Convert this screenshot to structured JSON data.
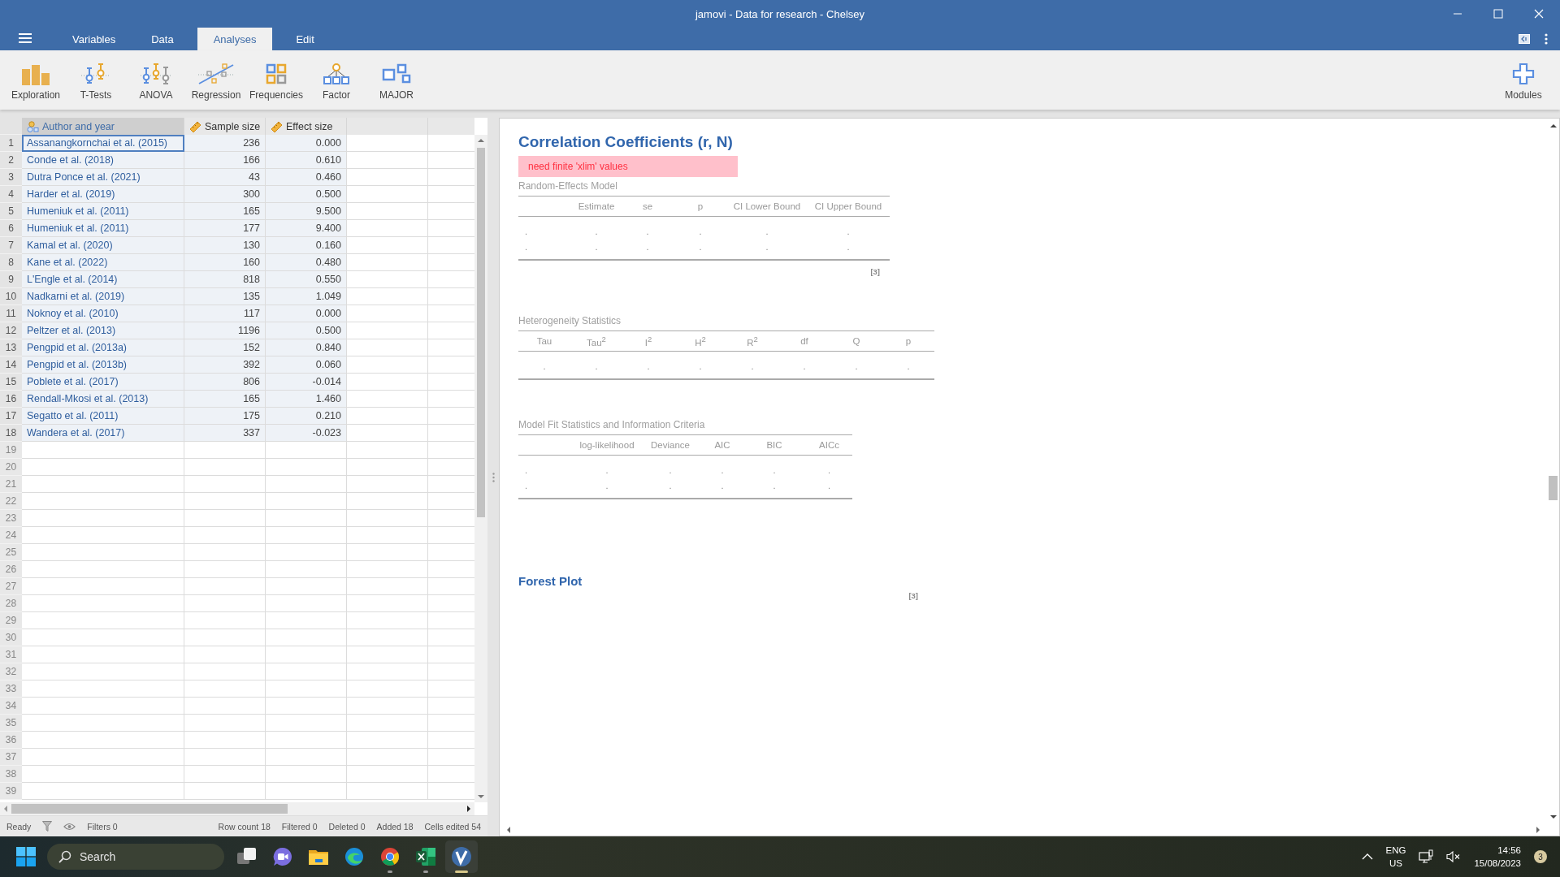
{
  "window": {
    "title": "jamovi - Data for research - Chelsey"
  },
  "menu_tabs": [
    {
      "label": "Variables",
      "selected": false
    },
    {
      "label": "Data",
      "selected": false
    },
    {
      "label": "Analyses",
      "selected": true
    },
    {
      "label": "Edit",
      "selected": false
    }
  ],
  "toolbar": [
    {
      "label": "Exploration",
      "kind": "exploration"
    },
    {
      "label": "T-Tests",
      "kind": "ttests"
    },
    {
      "label": "ANOVA",
      "kind": "anova"
    },
    {
      "label": "Regression",
      "kind": "regression"
    },
    {
      "label": "Frequencies",
      "kind": "frequencies"
    },
    {
      "label": "Factor",
      "kind": "factor"
    },
    {
      "label": "MAJOR",
      "kind": "major"
    }
  ],
  "modules": {
    "label": "Modules"
  },
  "spreadsheet": {
    "columns": [
      {
        "name": "Author and year",
        "kind": "nominal",
        "selected": true
      },
      {
        "name": "Sample size",
        "kind": "continuous",
        "selected": false
      },
      {
        "name": "Effect size",
        "kind": "continuous",
        "selected": false
      }
    ],
    "rows": [
      {
        "number": "1",
        "cells": [
          "Assanangkornchai et al. (2015)",
          "236",
          "0.000"
        ],
        "selected": true
      },
      {
        "number": "2",
        "cells": [
          "Conde et al. (2018)",
          "166",
          "0.610"
        ],
        "selected": false
      },
      {
        "number": "3",
        "cells": [
          "Dutra Ponce et al. (2021)",
          "43",
          "0.460"
        ],
        "selected": false
      },
      {
        "number": "4",
        "cells": [
          "Harder et al. (2019)",
          "300",
          "0.500"
        ],
        "selected": false
      },
      {
        "number": "5",
        "cells": [
          "Humeniuk et al. (2011)",
          "165",
          "9.500"
        ],
        "selected": false
      },
      {
        "number": "6",
        "cells": [
          "Humeniuk et al. (2011)",
          "177",
          "9.400"
        ],
        "selected": false
      },
      {
        "number": "7",
        "cells": [
          "Kamal et al. (2020)",
          "130",
          "0.160"
        ],
        "selected": false
      },
      {
        "number": "8",
        "cells": [
          "Kane et al. (2022)",
          "160",
          "0.480"
        ],
        "selected": false
      },
      {
        "number": "9",
        "cells": [
          "L'Engle et al. (2014)",
          "818",
          "0.550"
        ],
        "selected": false
      },
      {
        "number": "10",
        "cells": [
          "Nadkarni et al. (2019)",
          "135",
          "1.049"
        ],
        "selected": false
      },
      {
        "number": "11",
        "cells": [
          "Noknoy et al. (2010)",
          "117",
          "0.000"
        ],
        "selected": false
      },
      {
        "number": "12",
        "cells": [
          "Peltzer et al. (2013)",
          "1196",
          "0.500"
        ],
        "selected": false
      },
      {
        "number": "13",
        "cells": [
          "Pengpid et al. (2013a)",
          "152",
          "0.840"
        ],
        "selected": false
      },
      {
        "number": "14",
        "cells": [
          "Pengpid et al. (2013b)",
          "392",
          "0.060"
        ],
        "selected": false
      },
      {
        "number": "15",
        "cells": [
          "Poblete et al. (2017)",
          "806",
          "-0.014"
        ],
        "selected": false
      },
      {
        "number": "16",
        "cells": [
          "Rendall-Mkosi et al. (2013)",
          "165",
          "1.460"
        ],
        "selected": false
      },
      {
        "number": "17",
        "cells": [
          "Segatto et al. (2011)",
          "175",
          "0.210"
        ],
        "selected": false
      },
      {
        "number": "18",
        "cells": [
          "Wandera et al. (2017)",
          "337",
          "-0.023"
        ],
        "selected": false
      }
    ],
    "empty_row_numbers": [
      "19",
      "20",
      "21",
      "22",
      "23",
      "24",
      "25",
      "26",
      "27",
      "28",
      "29",
      "30",
      "31",
      "32",
      "33",
      "34",
      "35",
      "36",
      "37",
      "38",
      "39"
    ]
  },
  "status_bar": {
    "status": "Ready",
    "filters": "Filters 0",
    "row_count": "Row count 18",
    "filtered": "Filtered 0",
    "deleted": "Deleted 0",
    "added": "Added 18",
    "cells_edited": "Cells edited 54"
  },
  "results": {
    "title": "Correlation Coefficients (r, N)",
    "error": "need finite 'xlim' values",
    "tables": [
      {
        "kind": "random_effects",
        "title": "Random-Effects Model",
        "columns": [
          "",
          "Estimate",
          "se",
          "p",
          "CI Lower Bound",
          "CI Upper Bound"
        ],
        "rows": [
          [
            ".",
            ".",
            ".",
            ".",
            ".",
            "."
          ],
          [
            ".",
            ".",
            ".",
            ".",
            ".",
            "."
          ]
        ],
        "footnote": "[3]"
      },
      {
        "kind": "heterogeneity",
        "title": "Heterogeneity Statistics",
        "columns": [
          "Tau",
          "Tau$^{2}$",
          "I$^{2}$",
          "H$^{2}$",
          "R$^{2}$",
          "df",
          "Q",
          "p"
        ],
        "rows": [
          [
            ".",
            ".",
            ".",
            ".",
            ".",
            ".",
            ".",
            "."
          ]
        ]
      },
      {
        "kind": "model_fit",
        "title": "Model Fit Statistics and Information Criteria",
        "columns": [
          "",
          "log-likelihood",
          "Deviance",
          "AIC",
          "BIC",
          "AICc"
        ],
        "rows": [
          [
            ".",
            ".",
            ".",
            ".",
            ".",
            "."
          ],
          [
            ".",
            ".",
            ".",
            ".",
            ".",
            "."
          ]
        ]
      }
    ],
    "forest_plot": {
      "title": "Forest Plot",
      "footnote": "[3]"
    }
  },
  "taskbar": {
    "search_placeholder": "Search",
    "apps": [
      {
        "kind": "task_view",
        "running": false,
        "active": false
      },
      {
        "kind": "video_chat",
        "running": false,
        "active": false
      },
      {
        "kind": "folder",
        "running": false,
        "active": false
      },
      {
        "kind": "swirl",
        "running": false,
        "active": false
      },
      {
        "kind": "ring",
        "running": true,
        "active": false
      },
      {
        "kind": "spreadsheet",
        "running": true,
        "active": false
      },
      {
        "kind": "app_logo",
        "running": true,
        "active": true
      }
    ],
    "language": "ENG",
    "region": "US",
    "muted": true,
    "time": "14:56",
    "date": "15/08/2023",
    "notifications": "3"
  }
}
